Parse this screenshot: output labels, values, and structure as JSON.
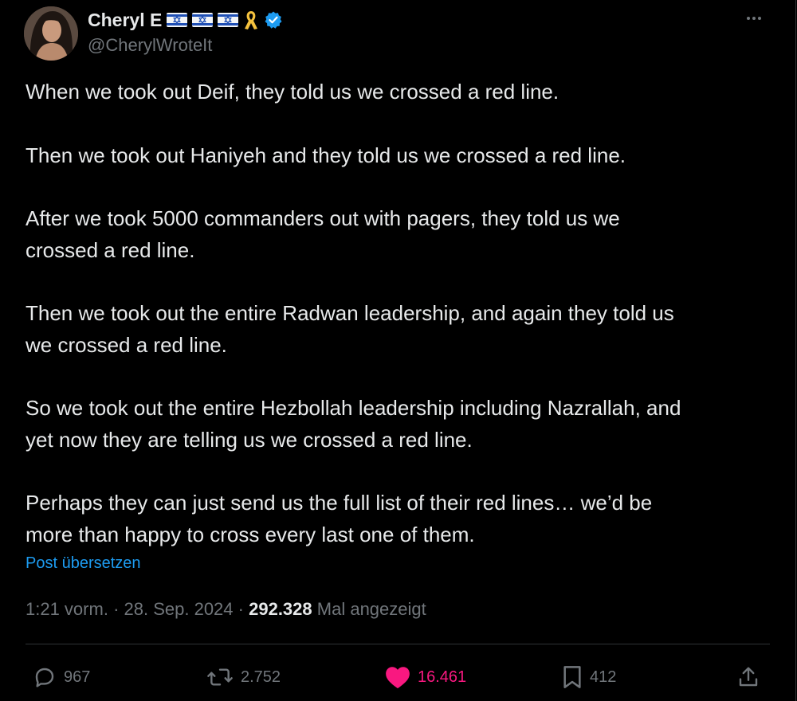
{
  "author": {
    "display_name": "Cheryl E",
    "handle": "@CherylWroteIt",
    "badges": [
      "israel-flag-icon",
      "israel-flag-icon",
      "israel-flag-icon",
      "yellow-ribbon-icon",
      "verified-badge-icon"
    ],
    "verified_color": "#1d9bf0"
  },
  "tweet": {
    "paragraphs": [
      "When we took out Deif, they told us we crossed a red line.",
      "Then we took out Haniyeh and they told us we crossed a red line.",
      "After we took 5000 commanders out with pagers, they told us we\ncrossed a red line.",
      "Then we took out the entire Radwan leadership, and again they told us\nwe crossed a red line.",
      "So we took out the entire Hezbollah leadership including Nazrallah, and\nyet now they are telling us we crossed a red line.",
      "Perhaps they can just send us the full list of their red lines… we’d be\nmore than happy to cross every last one of them."
    ],
    "translate_link": "Post übersetzen",
    "time": "1:21 vorm.",
    "date": "28. Sep. 2024",
    "views": "292.328",
    "views_label": "Mal angezeigt"
  },
  "actions": {
    "replies": "967",
    "reposts": "2.752",
    "likes": "16.461",
    "bookmarks": "412"
  },
  "colors": {
    "background": "#000000",
    "text": "#e7e9ea",
    "secondary": "#71767b",
    "link": "#1d9bf0",
    "like": "#f91880"
  }
}
